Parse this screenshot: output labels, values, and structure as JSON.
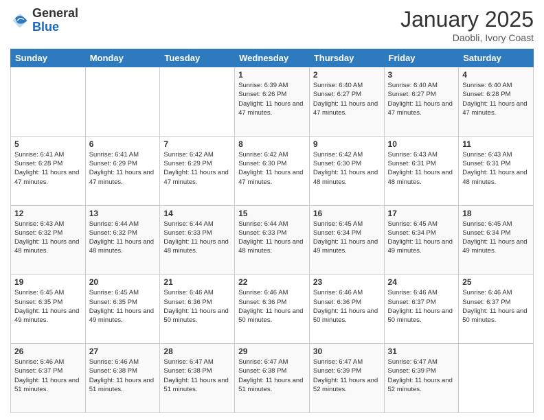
{
  "header": {
    "logo_general": "General",
    "logo_blue": "Blue",
    "month_title": "January 2025",
    "subtitle": "Daobli, Ivory Coast"
  },
  "days_of_week": [
    "Sunday",
    "Monday",
    "Tuesday",
    "Wednesday",
    "Thursday",
    "Friday",
    "Saturday"
  ],
  "weeks": [
    [
      {
        "day": "",
        "info": ""
      },
      {
        "day": "",
        "info": ""
      },
      {
        "day": "",
        "info": ""
      },
      {
        "day": "1",
        "info": "Sunrise: 6:39 AM\nSunset: 6:26 PM\nDaylight: 11 hours and 47 minutes."
      },
      {
        "day": "2",
        "info": "Sunrise: 6:40 AM\nSunset: 6:27 PM\nDaylight: 11 hours and 47 minutes."
      },
      {
        "day": "3",
        "info": "Sunrise: 6:40 AM\nSunset: 6:27 PM\nDaylight: 11 hours and 47 minutes."
      },
      {
        "day": "4",
        "info": "Sunrise: 6:40 AM\nSunset: 6:28 PM\nDaylight: 11 hours and 47 minutes."
      }
    ],
    [
      {
        "day": "5",
        "info": "Sunrise: 6:41 AM\nSunset: 6:28 PM\nDaylight: 11 hours and 47 minutes."
      },
      {
        "day": "6",
        "info": "Sunrise: 6:41 AM\nSunset: 6:29 PM\nDaylight: 11 hours and 47 minutes."
      },
      {
        "day": "7",
        "info": "Sunrise: 6:42 AM\nSunset: 6:29 PM\nDaylight: 11 hours and 47 minutes."
      },
      {
        "day": "8",
        "info": "Sunrise: 6:42 AM\nSunset: 6:30 PM\nDaylight: 11 hours and 47 minutes."
      },
      {
        "day": "9",
        "info": "Sunrise: 6:42 AM\nSunset: 6:30 PM\nDaylight: 11 hours and 48 minutes."
      },
      {
        "day": "10",
        "info": "Sunrise: 6:43 AM\nSunset: 6:31 PM\nDaylight: 11 hours and 48 minutes."
      },
      {
        "day": "11",
        "info": "Sunrise: 6:43 AM\nSunset: 6:31 PM\nDaylight: 11 hours and 48 minutes."
      }
    ],
    [
      {
        "day": "12",
        "info": "Sunrise: 6:43 AM\nSunset: 6:32 PM\nDaylight: 11 hours and 48 minutes."
      },
      {
        "day": "13",
        "info": "Sunrise: 6:44 AM\nSunset: 6:32 PM\nDaylight: 11 hours and 48 minutes."
      },
      {
        "day": "14",
        "info": "Sunrise: 6:44 AM\nSunset: 6:33 PM\nDaylight: 11 hours and 48 minutes."
      },
      {
        "day": "15",
        "info": "Sunrise: 6:44 AM\nSunset: 6:33 PM\nDaylight: 11 hours and 48 minutes."
      },
      {
        "day": "16",
        "info": "Sunrise: 6:45 AM\nSunset: 6:34 PM\nDaylight: 11 hours and 49 minutes."
      },
      {
        "day": "17",
        "info": "Sunrise: 6:45 AM\nSunset: 6:34 PM\nDaylight: 11 hours and 49 minutes."
      },
      {
        "day": "18",
        "info": "Sunrise: 6:45 AM\nSunset: 6:34 PM\nDaylight: 11 hours and 49 minutes."
      }
    ],
    [
      {
        "day": "19",
        "info": "Sunrise: 6:45 AM\nSunset: 6:35 PM\nDaylight: 11 hours and 49 minutes."
      },
      {
        "day": "20",
        "info": "Sunrise: 6:45 AM\nSunset: 6:35 PM\nDaylight: 11 hours and 49 minutes."
      },
      {
        "day": "21",
        "info": "Sunrise: 6:46 AM\nSunset: 6:36 PM\nDaylight: 11 hours and 50 minutes."
      },
      {
        "day": "22",
        "info": "Sunrise: 6:46 AM\nSunset: 6:36 PM\nDaylight: 11 hours and 50 minutes."
      },
      {
        "day": "23",
        "info": "Sunrise: 6:46 AM\nSunset: 6:36 PM\nDaylight: 11 hours and 50 minutes."
      },
      {
        "day": "24",
        "info": "Sunrise: 6:46 AM\nSunset: 6:37 PM\nDaylight: 11 hours and 50 minutes."
      },
      {
        "day": "25",
        "info": "Sunrise: 6:46 AM\nSunset: 6:37 PM\nDaylight: 11 hours and 50 minutes."
      }
    ],
    [
      {
        "day": "26",
        "info": "Sunrise: 6:46 AM\nSunset: 6:37 PM\nDaylight: 11 hours and 51 minutes."
      },
      {
        "day": "27",
        "info": "Sunrise: 6:46 AM\nSunset: 6:38 PM\nDaylight: 11 hours and 51 minutes."
      },
      {
        "day": "28",
        "info": "Sunrise: 6:47 AM\nSunset: 6:38 PM\nDaylight: 11 hours and 51 minutes."
      },
      {
        "day": "29",
        "info": "Sunrise: 6:47 AM\nSunset: 6:38 PM\nDaylight: 11 hours and 51 minutes."
      },
      {
        "day": "30",
        "info": "Sunrise: 6:47 AM\nSunset: 6:39 PM\nDaylight: 11 hours and 52 minutes."
      },
      {
        "day": "31",
        "info": "Sunrise: 6:47 AM\nSunset: 6:39 PM\nDaylight: 11 hours and 52 minutes."
      },
      {
        "day": "",
        "info": ""
      }
    ]
  ]
}
